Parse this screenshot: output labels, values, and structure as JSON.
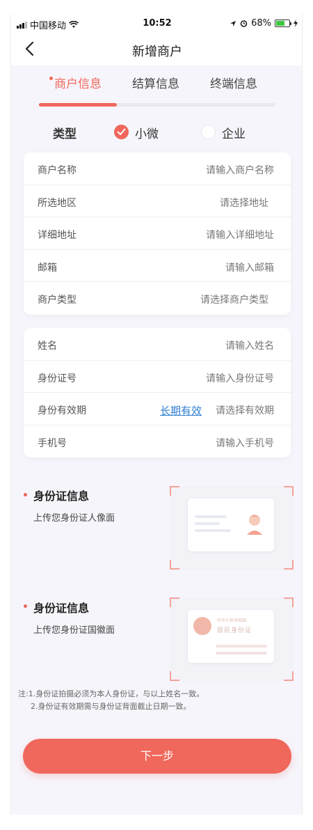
{
  "status_bar": {
    "carrier": "中国移动",
    "time": "10:52",
    "battery": "68%",
    "battery_level": 0.68
  },
  "nav": {
    "title": "新增商户"
  },
  "tabs": [
    {
      "label": "商户信息"
    },
    {
      "label": "结算信息"
    },
    {
      "label": "终端信息"
    }
  ],
  "tab_progress": 0.33,
  "type": {
    "label": "类型",
    "options": [
      "小微",
      "企业"
    ],
    "selected": "小微"
  },
  "merchant_form": [
    {
      "label": "商户名称",
      "placeholder": "请输入商户名称"
    },
    {
      "label": "所选地区",
      "placeholder": "请选择地址"
    },
    {
      "label": "详细地址",
      "placeholder": "请输入详细地址"
    },
    {
      "label": "邮箱",
      "placeholder": "请输入邮箱"
    },
    {
      "label": "商户类型",
      "placeholder": "请选择商户类型"
    }
  ],
  "person_form": [
    {
      "label": "姓名",
      "placeholder": "请输入姓名"
    },
    {
      "label": "身份证号",
      "placeholder": "请输入身份证号"
    },
    {
      "label": "身份有效期",
      "placeholder": "请选择有效期",
      "link": "长期有效"
    },
    {
      "label": "手机号",
      "placeholder": "请输入手机号"
    }
  ],
  "uploads": [
    {
      "title": "身份证信息",
      "subtitle": "上传您身份证人像面"
    },
    {
      "title": "身份证信息",
      "subtitle": "上传您身份证国徽面"
    }
  ],
  "id_back_text": {
    "line1": "中华人民共和国",
    "line2": "居民身份证"
  },
  "notes": [
    "注:1.身份证拍摄必须为本人身份证，与以上姓名一致。",
    "2.身份证有效期需与身份证背面截止日期一致。"
  ],
  "next_button": "下一步",
  "colors": {
    "accent": "#f0675b",
    "link": "#2f7fd1",
    "background": "#f6f5fb"
  }
}
